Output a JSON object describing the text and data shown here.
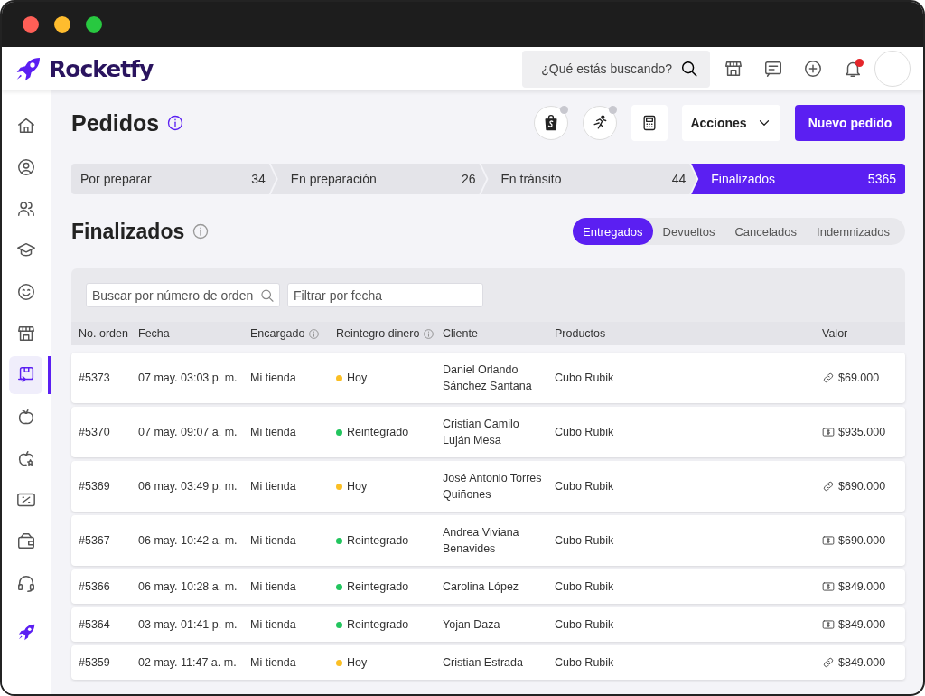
{
  "header": {
    "brand": "Rocketfy",
    "search": {
      "placeholder": "¿Qué estás buscando?"
    },
    "notifications": {
      "unread": true
    }
  },
  "sidebar": {
    "items": [
      {
        "selected": false
      },
      {
        "selected": false
      },
      {
        "selected": false
      },
      {
        "selected": false
      },
      {
        "selected": false
      },
      {
        "selected": false
      },
      {
        "selected": true
      },
      {
        "selected": false
      },
      {
        "selected": false
      },
      {
        "selected": false
      },
      {
        "selected": false
      },
      {
        "selected": false
      }
    ]
  },
  "page": {
    "title": "Pedidos",
    "actions": {
      "dropdown": "Acciones",
      "primary": "Nuevo pedido"
    }
  },
  "steps": [
    {
      "label": "Por preparar",
      "count": "34",
      "selected": false
    },
    {
      "label": "En preparación",
      "count": "26",
      "selected": false
    },
    {
      "label": "En tránsito",
      "count": "44",
      "selected": false
    },
    {
      "label": "Finalizados",
      "count": "5365",
      "selected": true
    }
  ],
  "section": {
    "title": "Finalizados",
    "tabs": [
      {
        "label": "Entregados",
        "selected": true
      },
      {
        "label": "Devueltos",
        "selected": false
      },
      {
        "label": "Cancelados",
        "selected": false
      },
      {
        "label": "Indemnizados",
        "selected": false
      }
    ]
  },
  "filters": {
    "order_search": {
      "placeholder": "Buscar por número de orden"
    },
    "date_filter": {
      "placeholder": "Filtrar por fecha"
    }
  },
  "table": {
    "columns": [
      {
        "label": "No. orden",
        "info": false
      },
      {
        "label": "Fecha",
        "info": false
      },
      {
        "label": "Encargado",
        "info": true
      },
      {
        "label": "Reintegro dinero",
        "info": true
      },
      {
        "label": "Cliente",
        "info": false
      },
      {
        "label": "Productos",
        "info": false
      },
      {
        "label": "Valor",
        "info": false
      }
    ],
    "rows": [
      {
        "order": "#5373",
        "date": "07 may. 03:03 p. m.",
        "assignee": "Mi tienda",
        "refund": "Hoy",
        "color": "#fbbf24",
        "client": "Daniel Orlando Sánchez Santana",
        "product": "Cubo Rubik",
        "kind": "link",
        "value": "$69.000"
      },
      {
        "order": "#5370",
        "date": "07 may. 09:07 a. m.",
        "assignee": "Mi tienda",
        "refund": "Reintegrado",
        "color": "#22c55e",
        "client": "Cristian Camilo Luján Mesa",
        "product": "Cubo Rubik",
        "kind": "cash",
        "value": "$935.000"
      },
      {
        "order": "#5369",
        "date": "06 may. 03:49 p. m.",
        "assignee": "Mi tienda",
        "refund": "Hoy",
        "color": "#fbbf24",
        "client": "José Antonio Torres Quiñones",
        "product": "Cubo Rubik",
        "kind": "link",
        "value": "$690.000"
      },
      {
        "order": "#5367",
        "date": "06 may. 10:42 a. m.",
        "assignee": "Mi tienda",
        "refund": "Reintegrado",
        "color": "#22c55e",
        "client": "Andrea Viviana Benavides",
        "product": "Cubo Rubik",
        "kind": "cash",
        "value": "$690.000"
      },
      {
        "order": "#5366",
        "date": "06 may. 10:28 a. m.",
        "assignee": "Mi tienda",
        "refund": "Reintegrado",
        "color": "#22c55e",
        "client": "Carolina López",
        "product": "Cubo Rubik",
        "kind": "cash",
        "value": "$849.000"
      },
      {
        "order": "#5364",
        "date": "03 may. 01:41 p. m.",
        "assignee": "Mi tienda",
        "refund": "Reintegrado",
        "color": "#22c55e",
        "client": "Yojan Daza",
        "product": "Cubo Rubik",
        "kind": "cash",
        "value": "$849.000"
      },
      {
        "order": "#5359",
        "date": "02 may. 11:47 a. m.",
        "assignee": "Mi tienda",
        "refund": "Hoy",
        "color": "#fbbf24",
        "client": "Cristian Estrada",
        "product": "Cubo Rubik",
        "kind": "link",
        "value": "$849.000"
      }
    ]
  }
}
